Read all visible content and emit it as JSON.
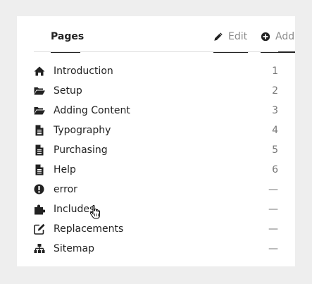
{
  "tabs": {
    "pages_label": "Pages",
    "edit_label": "Edit",
    "add_label": "Add"
  },
  "items": [
    {
      "label": "Introduction",
      "count": "1",
      "icon": "home-icon"
    },
    {
      "label": "Setup",
      "count": "2",
      "icon": "folder-open-icon"
    },
    {
      "label": "Adding Content",
      "count": "3",
      "icon": "folder-open-icon"
    },
    {
      "label": "Typography",
      "count": "4",
      "icon": "file-text-icon"
    },
    {
      "label": "Purchasing",
      "count": "5",
      "icon": "file-text-icon"
    },
    {
      "label": "Help",
      "count": "6",
      "icon": "file-text-icon"
    },
    {
      "label": "error",
      "count": "—",
      "icon": "exclamation-circle-icon"
    },
    {
      "label": "Includes",
      "count": "—",
      "icon": "puzzle-icon"
    },
    {
      "label": "Replacements",
      "count": "—",
      "icon": "edit-icon"
    },
    {
      "label": "Sitemap",
      "count": "—",
      "icon": "sitemap-icon"
    }
  ],
  "colors": {
    "background": "#eeeeee",
    "panel": "#ffffff",
    "text": "#222222",
    "muted": "#777777"
  }
}
